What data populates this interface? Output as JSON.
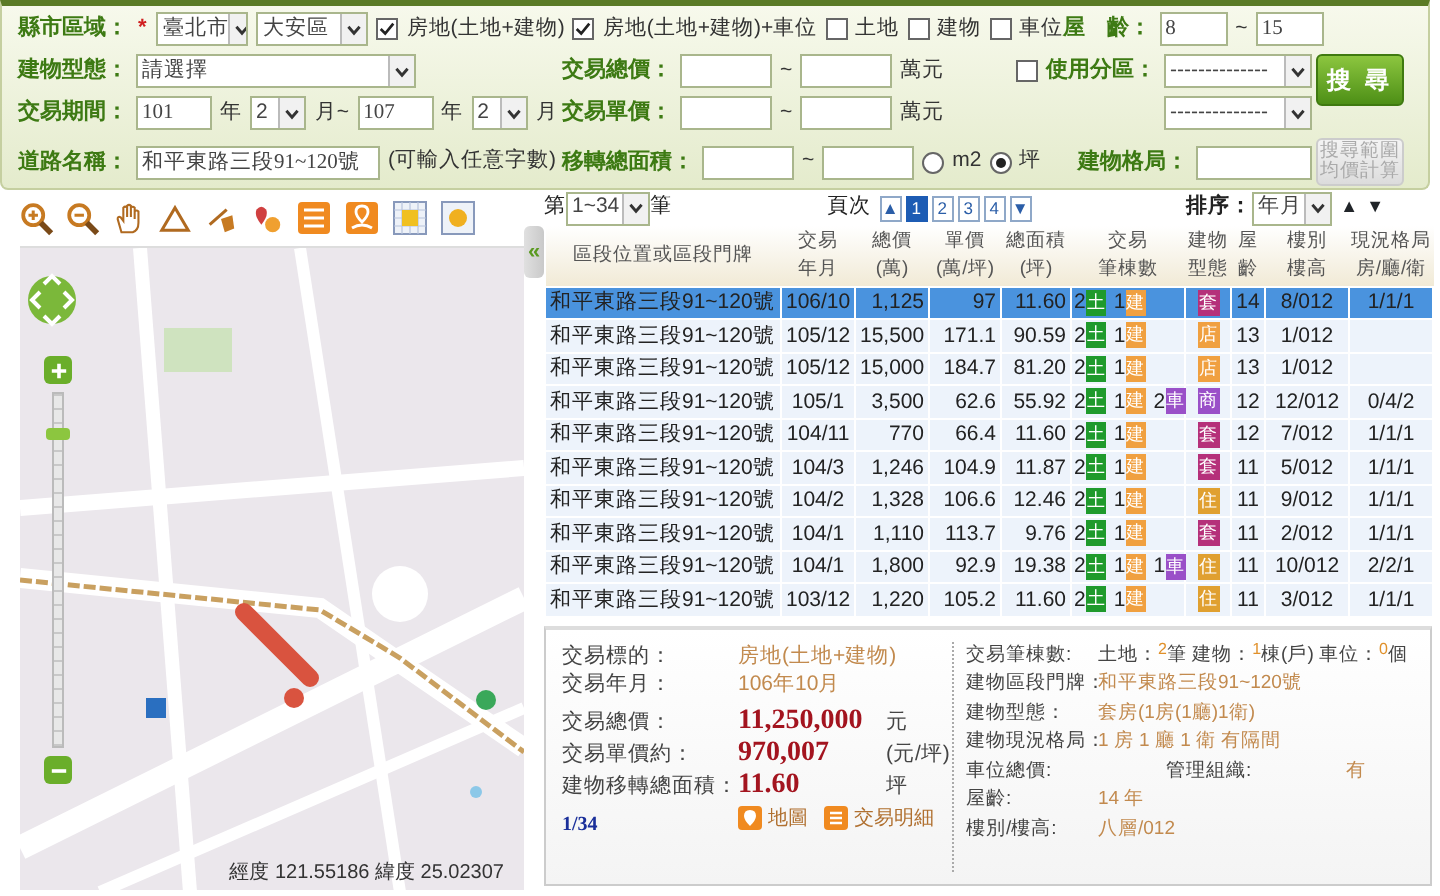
{
  "search_form": {
    "region": [
      {
        "kind": "label",
        "value": "縣市區域："
      },
      {
        "kind": "mark",
        "value": "*"
      },
      {
        "kind": "select",
        "value": "臺北市"
      },
      {
        "kind": "select",
        "value": "大安區"
      },
      {
        "kind": "checkbox",
        "label": "房地(土地+建物)",
        "checked": true
      },
      {
        "kind": "checkbox",
        "label": "房地(土地+建物)+車位",
        "checked": true
      },
      {
        "kind": "checkbox",
        "label": "土地",
        "checked": false
      },
      {
        "kind": "checkbox",
        "label": "建物",
        "checked": false
      },
      {
        "kind": "checkbox",
        "label": "車位",
        "checked": false
      }
    ],
    "age": [
      {
        "kind": "label",
        "value": "屋　齡："
      },
      {
        "kind": "input",
        "value": "8"
      },
      {
        "kind": "text",
        "value": "~"
      },
      {
        "kind": "input",
        "value": "15"
      }
    ],
    "building_type": [
      {
        "kind": "label",
        "value": "建物型態："
      },
      {
        "kind": "select",
        "value": "請選擇"
      }
    ],
    "total_price": [
      {
        "kind": "label",
        "value": "交易總價："
      },
      {
        "kind": "input"
      },
      {
        "kind": "text",
        "value": "~"
      },
      {
        "kind": "input"
      },
      {
        "kind": "text",
        "value": "萬元"
      }
    ],
    "zoning": [
      {
        "kind": "checkbox",
        "label": "使用分區：",
        "checked": false
      },
      {
        "kind": "select",
        "value": "--------------"
      }
    ],
    "period": [
      {
        "kind": "label",
        "value": "交易期間："
      },
      {
        "kind": "input",
        "value": "101"
      },
      {
        "kind": "text",
        "value": "年"
      },
      {
        "kind": "select",
        "value": "2"
      },
      {
        "kind": "text",
        "value": "月~"
      },
      {
        "kind": "input",
        "value": "107"
      },
      {
        "kind": "text",
        "value": "年"
      },
      {
        "kind": "select",
        "value": "2"
      },
      {
        "kind": "text",
        "value": "月"
      }
    ],
    "unit_price": [
      {
        "kind": "label",
        "value": "交易單價："
      },
      {
        "kind": "input"
      },
      {
        "kind": "text",
        "value": "~"
      },
      {
        "kind": "input"
      },
      {
        "kind": "text",
        "value": "萬元"
      }
    ],
    "zoning_sub": [
      {
        "kind": "select",
        "value": "--------------"
      }
    ],
    "road": [
      {
        "kind": "label",
        "value": "道路名稱："
      },
      {
        "kind": "input",
        "value": "和平東路三段91~120號"
      },
      {
        "kind": "hint",
        "value": "(可輸入任意字數)"
      }
    ],
    "area": [
      {
        "kind": "label",
        "value": "移轉總面積："
      },
      {
        "kind": "input"
      },
      {
        "kind": "text",
        "value": "~"
      },
      {
        "kind": "input"
      },
      {
        "kind": "radio",
        "label": "m2",
        "selected": false
      },
      {
        "kind": "radio",
        "label": "坪",
        "selected": true
      }
    ],
    "layout": [
      {
        "kind": "label",
        "value": "建物格局："
      },
      {
        "kind": "input"
      }
    ],
    "search_button": "搜 尋",
    "average_button": [
      "搜尋範圍",
      "均價計算"
    ]
  },
  "map": {
    "collapse": "«",
    "zoom": {
      "level": 0.9
    },
    "coordinates": "經度 121.55186 緯度 25.02307"
  },
  "results": {
    "range_prefix": "第",
    "range": "1~34",
    "range_suffix": "筆",
    "page_label": "頁次",
    "page_up": "▲",
    "pages": [
      {
        "label": "1",
        "selected": true
      },
      {
        "label": "2",
        "selected": false
      },
      {
        "label": "3",
        "selected": false
      },
      {
        "label": "4",
        "selected": false
      }
    ],
    "page_down": "▼",
    "sort_label": "排序：",
    "sort": "年月",
    "sort_asc": "▲",
    "sort_desc": "▼",
    "columns": [
      [
        "區段位置或區段門牌"
      ],
      [
        "交易",
        "年月"
      ],
      [
        "總價",
        "(萬)"
      ],
      [
        "單價",
        "(萬/坪)"
      ],
      [
        "總面積",
        "(坪)"
      ],
      [
        "交易",
        "筆棟數"
      ],
      [
        "建物",
        "型態"
      ],
      [
        "屋齡"
      ],
      [
        "樓別",
        "樓高"
      ],
      [
        "現況格局",
        "房/廳/衛"
      ]
    ],
    "rows": [
      {
        "address": "和平東路三段91~120號",
        "year_month": "106/10",
        "total": "1,125",
        "unit": "97",
        "area": "11.60",
        "land_count": "2",
        "land": "土",
        "building_count": "1",
        "building": "建",
        "type": "套",
        "color": "#b5307a",
        "age": "14",
        "floor": "8/012",
        "layout": "1/1/1",
        "selected": true
      },
      {
        "address": "和平東路三段91~120號",
        "year_month": "105/12",
        "total": "15,500",
        "unit": "171.1",
        "area": "90.59",
        "land_count": "2",
        "land": "土",
        "building_count": "1",
        "building": "建",
        "type": "店",
        "color": "#f0a040",
        "age": "13",
        "floor": "1/012",
        "selected": false
      },
      {
        "address": "和平東路三段91~120號",
        "year_month": "105/12",
        "total": "15,000",
        "unit": "184.7",
        "area": "81.20",
        "land_count": "2",
        "land": "土",
        "building_count": "1",
        "building": "建",
        "type": "店",
        "color": "#f0a040",
        "age": "13",
        "floor": "1/012",
        "selected": false
      },
      {
        "address": "和平東路三段91~120號",
        "year_month": "105/1",
        "total": "3,500",
        "unit": "62.6",
        "area": "55.92",
        "land_count": "2",
        "land": "土",
        "building_count": "1",
        "building": "建",
        "parking_count": "2",
        "parking": "車",
        "type": "商",
        "color": "#9a50c8",
        "age": "12",
        "floor": "12/012",
        "layout": "0/4/2",
        "selected": false
      },
      {
        "address": "和平東路三段91~120號",
        "year_month": "104/11",
        "total": "770",
        "unit": "66.4",
        "area": "11.60",
        "land_count": "2",
        "land": "土",
        "building_count": "1",
        "building": "建",
        "type": "套",
        "color": "#b5307a",
        "age": "12",
        "floor": "7/012",
        "layout": "1/1/1",
        "selected": false
      },
      {
        "address": "和平東路三段91~120號",
        "year_month": "104/3",
        "total": "1,246",
        "unit": "104.9",
        "area": "11.87",
        "land_count": "2",
        "land": "土",
        "building_count": "1",
        "building": "建",
        "type": "套",
        "color": "#b5307a",
        "age": "11",
        "floor": "5/012",
        "layout": "1/1/1",
        "selected": false
      },
      {
        "address": "和平東路三段91~120號",
        "year_month": "104/2",
        "total": "1,328",
        "unit": "106.6",
        "area": "12.46",
        "land_count": "2",
        "land": "土",
        "building_count": "1",
        "building": "建",
        "type": "住",
        "color": "#e0a030",
        "age": "11",
        "floor": "9/012",
        "layout": "1/1/1",
        "selected": false
      },
      {
        "address": "和平東路三段91~120號",
        "year_month": "104/1",
        "total": "1,110",
        "unit": "113.7",
        "area": "9.76",
        "land_count": "2",
        "land": "土",
        "building_count": "1",
        "building": "建",
        "type": "套",
        "color": "#b5307a",
        "age": "11",
        "floor": "2/012",
        "layout": "1/1/1",
        "selected": false
      },
      {
        "address": "和平東路三段91~120號",
        "year_month": "104/1",
        "total": "1,800",
        "unit": "92.9",
        "area": "19.38",
        "land_count": "2",
        "land": "土",
        "building_count": "1",
        "building": "建",
        "parking_count": "1",
        "parking": "車",
        "type": "住",
        "color": "#e0a030",
        "age": "11",
        "floor": "10/012",
        "layout": "2/2/1",
        "selected": false
      },
      {
        "address": "和平東路三段91~120號",
        "year_month": "103/12",
        "total": "1,220",
        "unit": "105.2",
        "area": "11.60",
        "land_count": "2",
        "land": "土",
        "building_count": "1",
        "building": "建",
        "type": "住",
        "color": "#e0a030",
        "age": "11",
        "floor": "3/012",
        "layout": "1/1/1",
        "selected": false
      }
    ]
  },
  "detail": {
    "left": [
      {
        "kind": "plain",
        "label": "交易標的：",
        "value": "房地(土地+建物)"
      },
      {
        "kind": "plain",
        "label": "交易年月：",
        "value": "106年10月"
      },
      {
        "kind": "big",
        "label": "交易總價：",
        "value": "11,250,000",
        "unit": "元"
      },
      {
        "kind": "big",
        "label": "交易單價約：",
        "value": "970,007",
        "unit": "(元/坪)"
      },
      {
        "kind": "big",
        "label": "建物移轉總面積：",
        "value": "11.60",
        "unit": "坪"
      }
    ],
    "position": "1/34",
    "map_button": "地圖",
    "detail_button": "交易明細",
    "counts_label": "交易筆棟數:",
    "counts": [
      {
        "kind": "text",
        "value": "土地："
      },
      {
        "kind": "num",
        "value": "2"
      },
      {
        "kind": "text",
        "value": "筆 建物："
      },
      {
        "kind": "num",
        "value": "1"
      },
      {
        "kind": "text",
        "value": "棟(戶) 車位："
      },
      {
        "kind": "num",
        "value": "0"
      },
      {
        "kind": "text",
        "value": "個"
      }
    ],
    "right": [
      {
        "label": "建物區段門牌：",
        "value": "和平東路三段91~120號"
      },
      {
        "label": "建物型態：",
        "value": "套房(1房(1廳)1衛)"
      },
      {
        "label": "建物現況格局：",
        "value": "1 房 1 廳 1 衛 有隔間"
      },
      {
        "label": "車位總價:",
        "extra_label": "管理組織:",
        "extra_value": "有"
      },
      {
        "label": "屋齡:",
        "value": "14 年"
      },
      {
        "label": "樓別/樓高:",
        "value": "八層/012"
      }
    ]
  }
}
